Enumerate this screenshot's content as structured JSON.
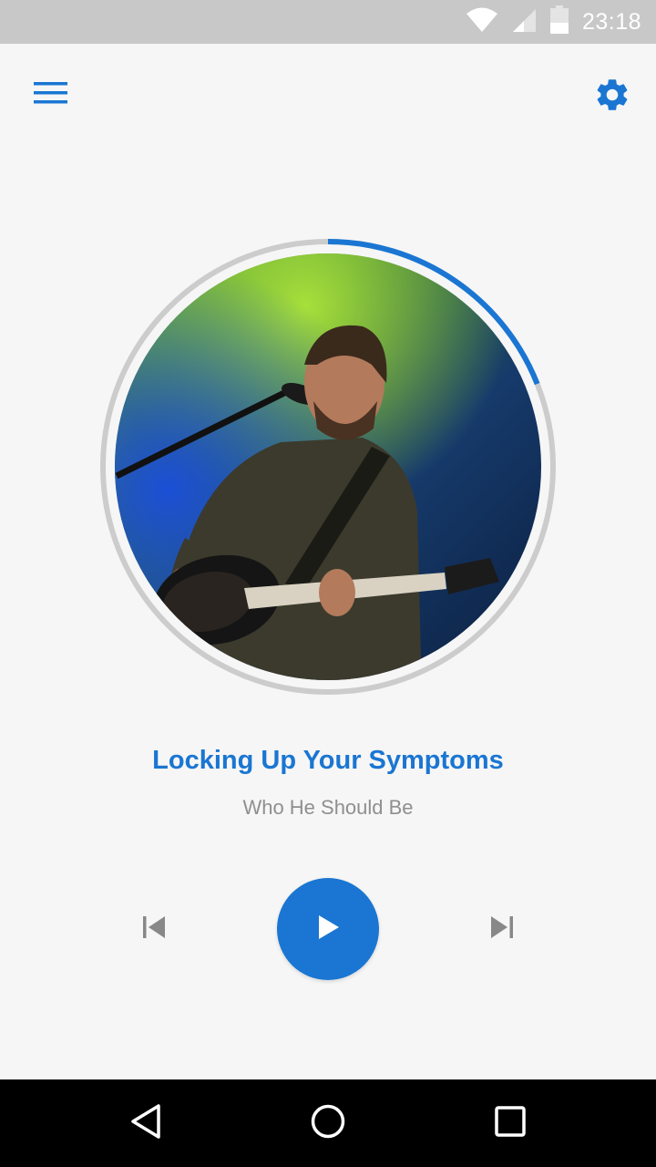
{
  "status_bar": {
    "time": "23:18",
    "icons": [
      "wifi-icon",
      "cell-signal-icon",
      "battery-icon"
    ],
    "background": "#c8c8c8"
  },
  "app_bar": {
    "menu_icon": "hamburger-menu-icon",
    "settings_icon": "gear-icon",
    "accent": "#1a76d2"
  },
  "player": {
    "track_title": "Locking Up Your Symptoms",
    "artist": "Who He Should Be",
    "progress_fraction": 0.19,
    "progress_color": "#1a76d2",
    "ring_color": "#cccccc",
    "artwork_alt": "album-art"
  },
  "controls": {
    "previous_icon": "skip-previous-icon",
    "play_icon": "play-icon",
    "next_icon": "skip-next-icon"
  },
  "nav_bar": {
    "back_icon": "back-icon",
    "home_icon": "home-icon",
    "recents_icon": "recents-icon"
  }
}
